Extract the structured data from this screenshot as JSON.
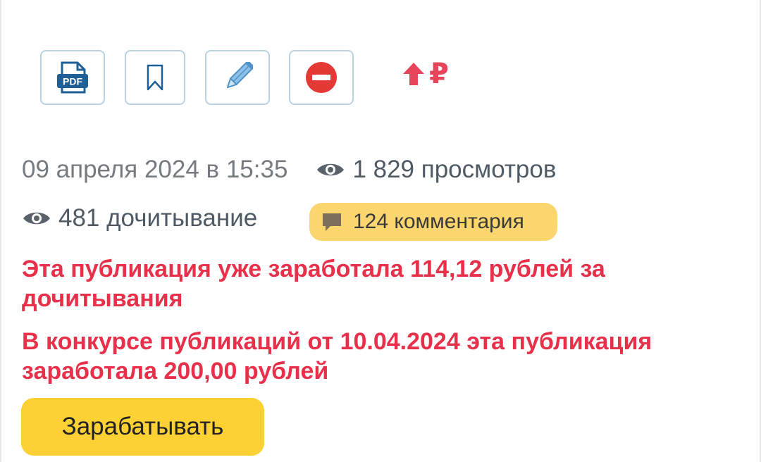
{
  "toolbar": {
    "pdf_text": "PDF",
    "ruble_symbol": "₽"
  },
  "meta": {
    "date": "09 апреля 2024 в 15:35",
    "views": "1 829 просмотров",
    "reads": "481 дочитывание",
    "comments": "124 комментария"
  },
  "earnings": {
    "line1": "Эта публикация уже заработала 114,12 рублей за дочитывания",
    "line2": "В конкурсе публикаций от 10.04.2024 эта публикация заработала 200,00 рублей"
  },
  "cta": {
    "label": "Зарабатывать"
  },
  "colors": {
    "accent_red": "#e8304a",
    "button_yellow": "#fdd034",
    "badge_yellow": "#fbd66e",
    "icon_blue": "#2f7fc1",
    "toolbar_border": "#b9d3e4"
  },
  "icons": [
    "pdf-icon",
    "bookmark-icon",
    "pencil-icon",
    "no-entry-icon",
    "arrow-up-icon",
    "eye-icon",
    "comment-icon"
  ]
}
